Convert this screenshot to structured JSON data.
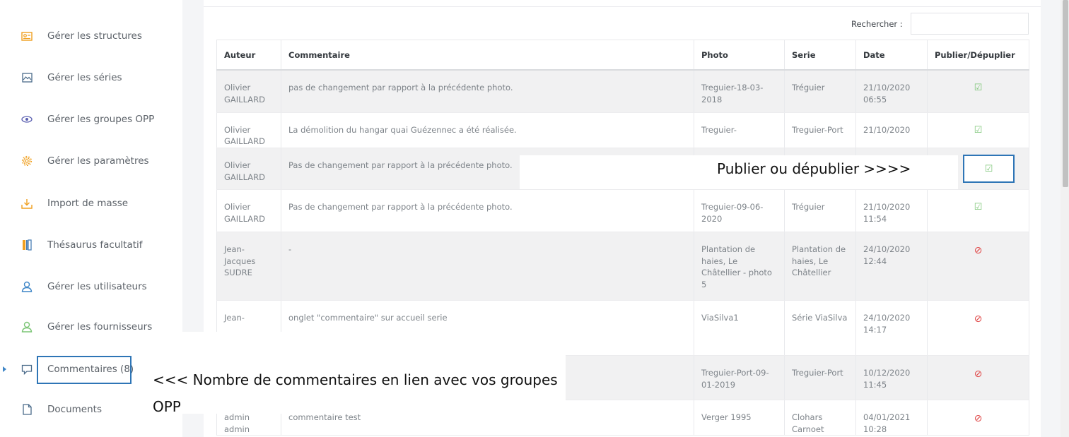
{
  "sidebar": {
    "items": [
      {
        "label": "Gérer les structures",
        "icon": "id-card-icon"
      },
      {
        "label": "Gérer les séries",
        "icon": "image-icon"
      },
      {
        "label": "Gérer les groupes OPP",
        "icon": "eye-icon"
      },
      {
        "label": "Gérer les paramètres",
        "icon": "gear-icon"
      },
      {
        "label": "Import de masse",
        "icon": "download-icon"
      },
      {
        "label": "Thésaurus facultatif",
        "icon": "book-icon"
      },
      {
        "label": "Gérer les utilisateurs",
        "icon": "user-icon"
      },
      {
        "label": "Gérer les fournisseurs",
        "icon": "user-icon"
      },
      {
        "label": "Commentaires (8)",
        "icon": "comment-icon"
      },
      {
        "label": "Documents",
        "icon": "document-icon"
      }
    ],
    "active_index": 8
  },
  "search": {
    "label": "Rechercher :",
    "value": ""
  },
  "table": {
    "headers": [
      "Auteur",
      "Commentaire",
      "Photo",
      "Serie",
      "Date",
      "Publier/Dépuplier"
    ],
    "rows": [
      {
        "auteur": "Olivier GAILLARD",
        "commentaire": "pas de changement par rapport à la précédente photo.",
        "photo": "Treguier-18-03-2018",
        "serie": "Tréguier",
        "date": "21/10/2020 06:55",
        "published": true
      },
      {
        "auteur": "Olivier GAILLARD",
        "commentaire": "La démolition du hangar quai Guézennec a été réalisée.",
        "photo": "Treguier-",
        "serie": "Treguier-Port",
        "date": "21/10/2020",
        "published": true
      },
      {
        "auteur": "Olivier GAILLARD",
        "commentaire": "Pas de changement par rapport à la précédente photo.",
        "photo": "",
        "serie": "",
        "date": "",
        "published": true
      },
      {
        "auteur": "Olivier GAILLARD",
        "commentaire": "Pas de changement par rapport à la précédente photo.",
        "photo": "Treguier-09-06-2020",
        "serie": "Tréguier",
        "date": "21/10/2020 11:54",
        "published": true
      },
      {
        "auteur": "Jean-Jacques SUDRE",
        "commentaire": "-",
        "photo": "Plantation de haies, Le Châtellier - photo 5",
        "serie": "Plantation de haies, Le Châtellier",
        "date": "24/10/2020 12:44",
        "published": false
      },
      {
        "auteur": "Jean-",
        "commentaire": "onglet \"commentaire\" sur accueil serie",
        "photo": "ViaSilva1",
        "serie": "Série ViaSilva",
        "date": "24/10/2020 14:17",
        "published": false
      },
      {
        "auteur": "",
        "commentaire": "",
        "photo": "Treguier-Port-09-01-2019",
        "serie": "Treguier-Port",
        "date": "10/12/2020 11:45",
        "published": false
      },
      {
        "auteur": "admin admin",
        "commentaire": "commentaire test",
        "photo": "Verger 1995",
        "serie": "Clohars Carnoet",
        "date": "04/01/2021 10:28",
        "published": false
      }
    ]
  },
  "annotations": {
    "publish_hint": "Publier ou dépublier >>>>",
    "comments_hint": "<<< Nombre de commentaires en lien avec vos groupes OPP"
  },
  "colors": {
    "accent": "#2e75b6",
    "published": "#7cc576",
    "unpublished": "#e04848",
    "icon_orange": "#f0a020",
    "icon_blue": "#4a7fb5",
    "icon_green": "#7cc576"
  }
}
